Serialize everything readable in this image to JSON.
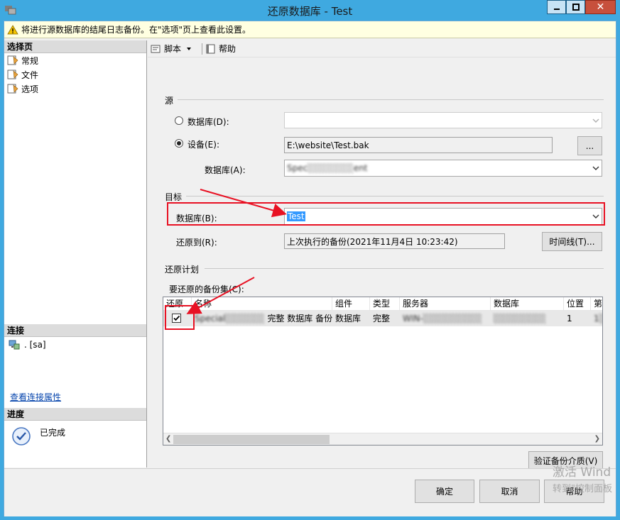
{
  "window": {
    "title": "还原数据库 - Test",
    "min_glyph": "―",
    "max_glyph": "□",
    "close_glyph": "✕"
  },
  "infobar": {
    "text": "将进行源数据库的结尾日志备份。在\"选项\"页上查看此设置。",
    "icon": "warning-icon"
  },
  "sidebar": {
    "section_title": "选择页",
    "items": [
      {
        "label": "常规",
        "icon": "page-icon"
      },
      {
        "label": "文件",
        "icon": "page-icon"
      },
      {
        "label": "选项",
        "icon": "page-icon"
      }
    ],
    "connection_title": "连接",
    "connection_value": ". [sa]",
    "connection_link": "查看连接属性",
    "progress_title": "进度",
    "progress_status": "已完成"
  },
  "toolbar": {
    "script_label": "脚本",
    "help_label": "帮助"
  },
  "source": {
    "section_label": "源",
    "database_radio_label": "数据库(D):",
    "device_radio_label": "设备(E):",
    "device_value": "E:\\website\\Test.bak",
    "browse_label": "...",
    "database_label": "数据库(A):",
    "database_value": "Spec░░░░░░░ent",
    "selected": "device"
  },
  "destination": {
    "section_label": "目标",
    "database_label": "数据库(B):",
    "database_value": "Test",
    "restore_to_label": "还原到(R):",
    "restore_to_value": "上次执行的备份(2021年11月4日 10:23:42)",
    "timeline_label": "时间线(T)..."
  },
  "plan": {
    "section_label": "还原计划",
    "backup_sets_label": "要还原的备份集(C):",
    "columns": [
      "还原",
      "名称",
      "组件",
      "类型",
      "服务器",
      "数据库",
      "位置",
      "第"
    ],
    "rows": [
      {
        "restore": true,
        "name_blurred": "Special░░░░░░",
        "name_suffix": "完整 数据库 备份",
        "component": "数据库",
        "type": "完整",
        "server": "WIN-░░░░░░░░░",
        "database": "░░░░░░░░",
        "position": "1",
        "first": "1░"
      }
    ],
    "verify_label": "验证备份介质(V)"
  },
  "buttons": {
    "ok": "确定",
    "cancel": "取消",
    "help": "帮助"
  },
  "watermark": {
    "line1": "激活 Wind",
    "line2": "转到\"控制面板"
  },
  "colors": {
    "titlebar": "#3fa9e0",
    "annotation_red": "#e81123",
    "selection": "#3399ff"
  }
}
